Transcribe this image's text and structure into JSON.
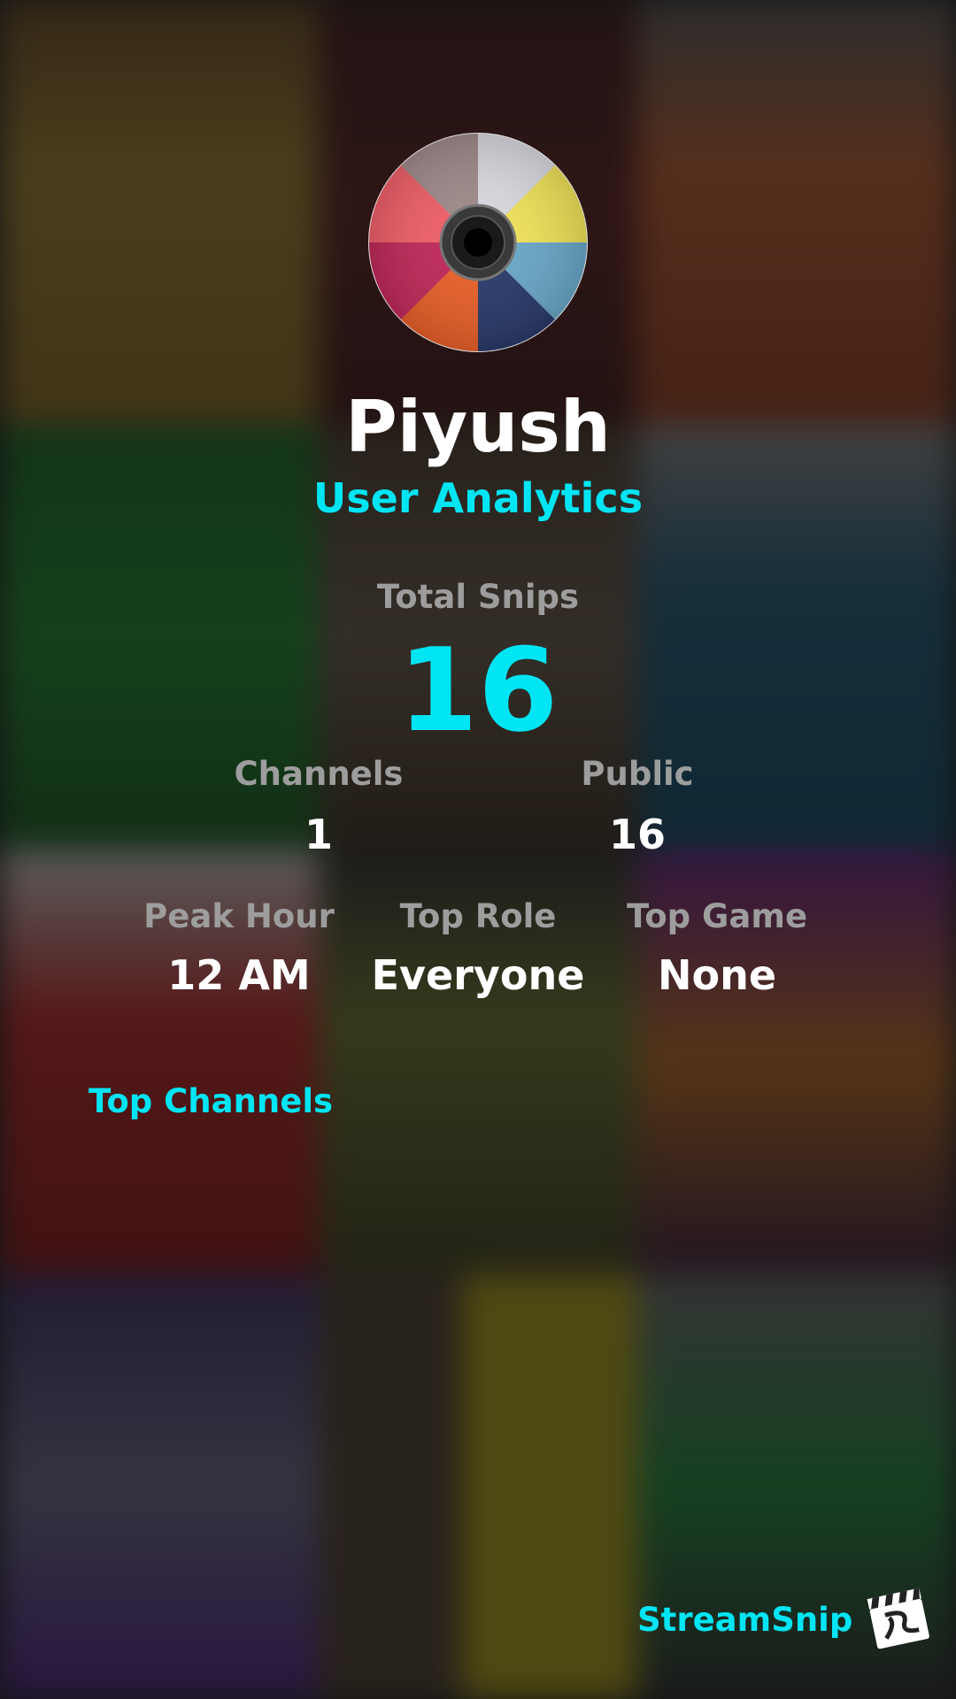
{
  "profile": {
    "username": "Piyush",
    "subtitle": "User Analytics",
    "avatar_icon": "cd-disc-icon"
  },
  "total": {
    "label": "Total Snips",
    "value": "16"
  },
  "stats_row1": [
    {
      "label": "Channels",
      "value": "1"
    },
    {
      "label": "Public",
      "value": "16"
    }
  ],
  "stats_row2": [
    {
      "label": "Peak Hour",
      "value": "12 AM"
    },
    {
      "label": "Top Role",
      "value": "Everyone"
    },
    {
      "label": "Top Game",
      "value": "None"
    }
  ],
  "sections": {
    "top_channels_title": "Top Channels"
  },
  "brand": {
    "name": "StreamSnip",
    "icon": "clapperboard-icon"
  },
  "colors": {
    "accent": "#00e5f4",
    "label": "#9d9d9d",
    "text": "#ffffff"
  }
}
